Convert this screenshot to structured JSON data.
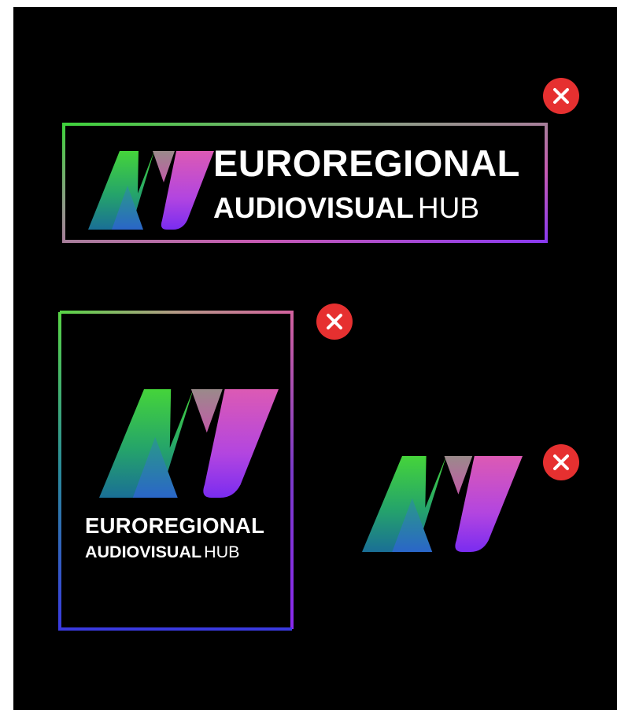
{
  "brand": {
    "line1": "EUROREGIONAL",
    "line2_bold": "AUDIOVISUAL",
    "line2_light": "HUB",
    "mark_text": "AV"
  },
  "icons": {
    "badge": "close-icon",
    "badge_color": "#e63030"
  },
  "colors": {
    "background": "#000000",
    "gradient_green": "#3bd23d",
    "gradient_pink": "#d25ab4",
    "gradient_purple": "#8a2be2",
    "gradient_teal": "#1a8a8a",
    "gradient_blue": "#2a4ad8"
  }
}
